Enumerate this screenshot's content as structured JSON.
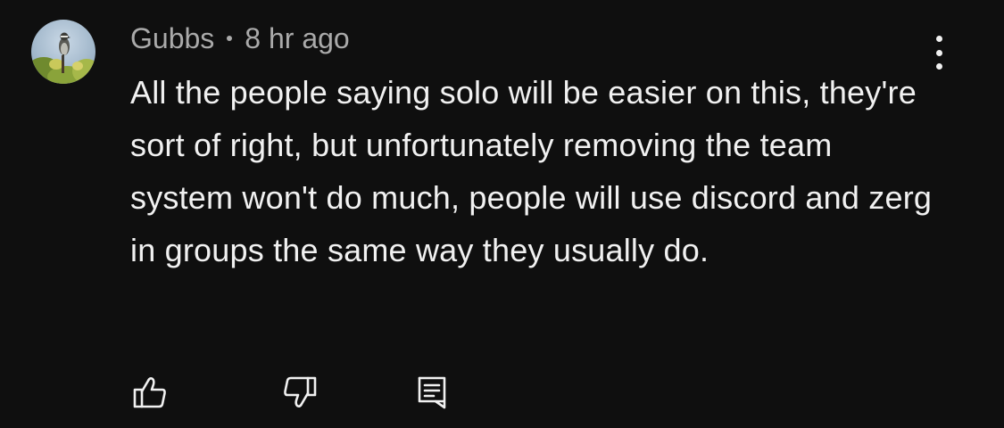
{
  "comment": {
    "author": "Gubbs",
    "separator_dot": "•",
    "time_ago": "8 hr ago",
    "text": "All the people saying solo will be easier on this, they're sort of right, but unfortunately removing the team system won't do much, people will use discord and zerg in groups the same way they usually do.",
    "avatar_icon": "bird-on-branch-avatar",
    "menu_icon": "more-vert-icon"
  },
  "actions": {
    "like_icon": "thumb-up-icon",
    "dislike_icon": "thumb-down-icon",
    "reply_icon": "reply-comment-icon"
  },
  "colors": {
    "background": "#0f0f0f",
    "primary_text": "#f1f1f1",
    "secondary_text": "#aaaaaa"
  }
}
